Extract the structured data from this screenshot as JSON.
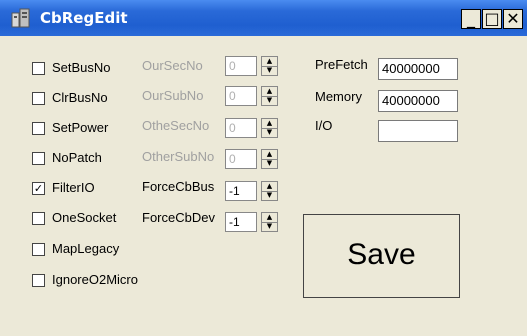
{
  "window": {
    "title": "CbRegEdit",
    "min_glyph": "_",
    "max_glyph": "□",
    "close_glyph": "✕",
    "colors": {
      "titlebar": "#2a6ad8",
      "background": "#ece9d8"
    }
  },
  "checkboxes": [
    {
      "label": "SetBusNo",
      "checked": false,
      "mark": ""
    },
    {
      "label": "ClrBusNo",
      "checked": false,
      "mark": ""
    },
    {
      "label": "SetPower",
      "checked": false,
      "mark": ""
    },
    {
      "label": "NoPatch",
      "checked": false,
      "mark": ""
    },
    {
      "label": "FilterIO",
      "checked": true,
      "mark": "✓"
    },
    {
      "label": "OneSocket",
      "checked": false,
      "mark": ""
    },
    {
      "label": "MapLegacy",
      "checked": false,
      "mark": ""
    },
    {
      "label": "IgnoreO2Micro",
      "checked": false,
      "mark": ""
    }
  ],
  "spinners": [
    {
      "label": "OurSecNo",
      "value": "0",
      "enabled": false
    },
    {
      "label": "OurSubNo",
      "value": "0",
      "enabled": false
    },
    {
      "label": "OtheSecNo",
      "value": "0",
      "enabled": false
    },
    {
      "label": "OtherSubNo",
      "value": "0",
      "enabled": false
    },
    {
      "label": "ForceCbBus",
      "value": "-1",
      "enabled": true
    },
    {
      "label": "ForceCbDev",
      "value": "-1",
      "enabled": true
    }
  ],
  "fields": [
    {
      "label": "PreFetch",
      "value": "40000000"
    },
    {
      "label": "Memory",
      "value": "40000000"
    },
    {
      "label": "I/O",
      "value": ""
    }
  ],
  "save_label": "Save"
}
